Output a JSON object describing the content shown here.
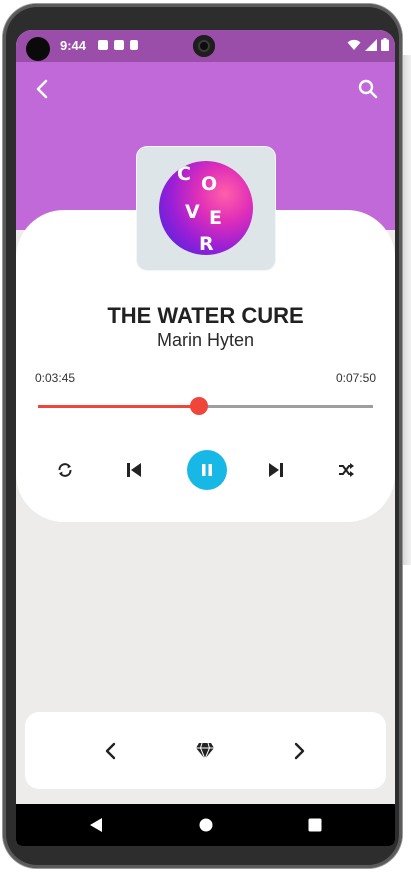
{
  "status_bar": {
    "time": "9:44",
    "icons": [
      "notification-a-icon",
      "notification-b-icon",
      "sd-card-icon",
      "wifi-icon",
      "signal-icon",
      "battery-icon"
    ]
  },
  "header": {
    "back_icon": "chevron-left-icon",
    "search_icon": "search-icon",
    "color": "#c269d9"
  },
  "cover": {
    "letters": [
      "C",
      "O",
      "V",
      "E",
      "R"
    ]
  },
  "track": {
    "title": "THE WATER CURE",
    "artist": "Marin Hyten",
    "current_time": "0:03:45",
    "total_time": "0:07:50",
    "progress": 0.48
  },
  "controls": {
    "repeat_icon": "repeat-icon",
    "prev_icon": "skip-previous-icon",
    "play_pause_icon": "pause-icon",
    "next_icon": "skip-next-icon",
    "shuffle_icon": "shuffle-icon",
    "accent": "#17b8e6",
    "seek_color": "#f0453a"
  },
  "bottom_bar": {
    "left_icon": "chevron-left-icon",
    "center_icon": "diamond-icon",
    "right_icon": "chevron-right-icon"
  },
  "nav": {
    "back_icon": "triangle-back-icon",
    "home_icon": "circle-home-icon",
    "recents_icon": "square-recents-icon"
  }
}
